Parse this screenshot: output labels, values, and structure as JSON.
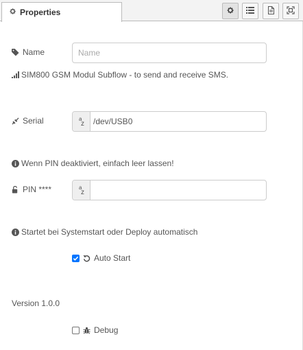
{
  "tabs": {
    "active_label": "Properties"
  },
  "toolbar": {
    "buttons": [
      "settings-icon",
      "list-icon",
      "document-icon",
      "expand-icon"
    ]
  },
  "form": {
    "name": {
      "label": "Name",
      "placeholder": "Name",
      "value": ""
    },
    "description": "SIM800 GSM Modul Subflow - to send and receive SMS.",
    "serial": {
      "label": "Serial",
      "value": "/dev/USB0"
    },
    "pin_hint": "Wenn PIN deaktiviert, einfach leer lassen!",
    "pin": {
      "label": "PIN ****",
      "value": ""
    },
    "autostart_hint": "Startet bei Systemstart oder Deploy automatisch",
    "autostart": {
      "label": "Auto Start",
      "checked": true
    },
    "version": "Version 1.0.0",
    "debug": {
      "label": "Debug",
      "checked": false
    }
  },
  "colors": {
    "accent": "#0075ff",
    "border": "#bbbbbb",
    "text": "#555555"
  }
}
